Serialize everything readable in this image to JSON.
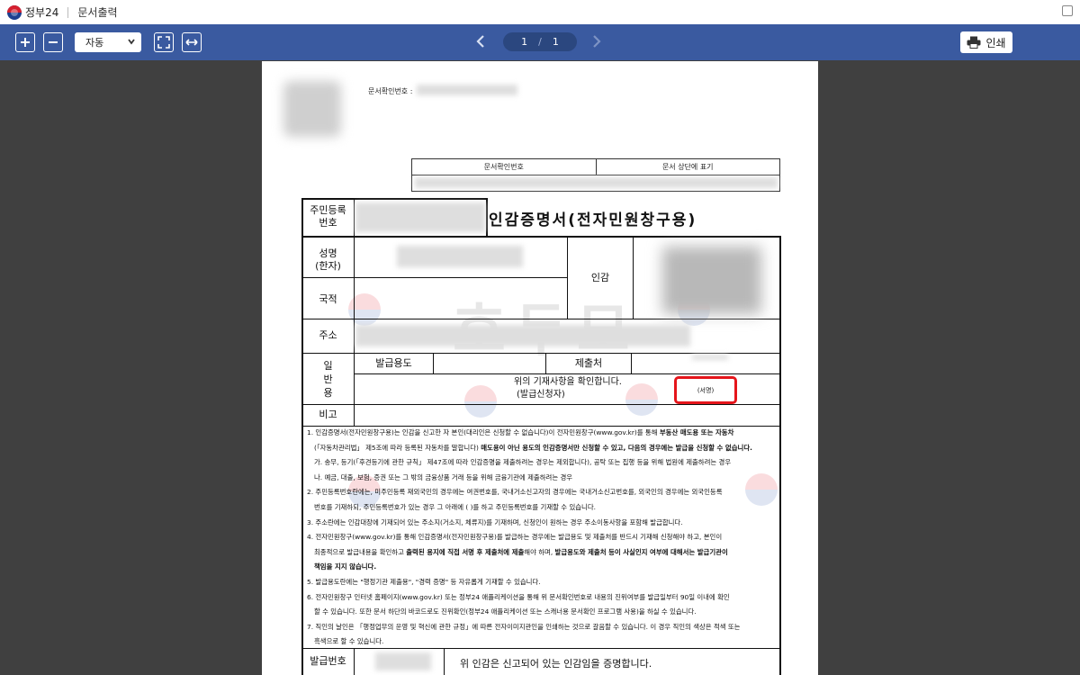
{
  "titlebar": {
    "brand": "정부24",
    "title": "문서출력"
  },
  "toolbar": {
    "zoom_in_icon": "plus-icon",
    "zoom_out_icon": "minus-icon",
    "zoom_select": "자동",
    "fit_page_icon": "expand-icon",
    "fit_width_icon": "arrows-horizontal-icon",
    "current_page": "1",
    "page_separator": "/",
    "total_pages": "1",
    "print_label": "인쇄",
    "accent": "#3a5aa0"
  },
  "document": {
    "confirm_number_label": "문서확인번호 :",
    "confirm_table": {
      "header_left": "문서확인번호",
      "header_right": "문서 상단에 표기"
    },
    "resident_label_1": "주민등록",
    "resident_label_2": "번호",
    "title": "인감증명서(전자민원창구용)",
    "name_label_1": "성명",
    "name_label_2": "(한자)",
    "seal_label": "인감",
    "nationality_label": "국적",
    "address_label": "주소",
    "general_label_1": "일",
    "general_label_2": "반",
    "general_label_3": "용",
    "purpose_label": "발급용도",
    "submit_to_label": "제출처",
    "confirm_statement": "위의 기재사항을 확인합니다.",
    "applicant_label": "(발급신청자)",
    "signature_label": "(서명)",
    "remarks_label": "비고",
    "watermark": "호두모",
    "notes": [
      "1. 인감증명서(전자민원창구용)는 인감을 신고한 자 본인(대리인은 신청할 수 없습니다)이 전자민원창구(www.gov.kr)를 통해 부동산 매도용 또는 자동차",
      "(「자동차관리법」 제5조에 따라 등록된 자동차를 말합니다) 매도용이 아닌 용도의 인감증명서만 신청할 수 있고, 다음의 경우에는 발급을 신청할 수 없습니다.",
      "가. 송무, 등기(「후견등기에 관한 규칙」 제47조에 따라 인감증명을 제출하려는 경우는 제외합니다), 공탁 또는 집행 등을 위해 법원에 제출하려는 경우",
      "나. 예금, 대출, 보험, 증권 또는 그 밖의 금융상품 거래 등을 위해 금융기관에 제출하려는 경우",
      "2. 주민등록번호란에는, 미주민등록 재외국민의 경우에는 여권번호를, 국내거소신고자의 경우에는 국내거소신고번호를, 외국인의 경우에는 외국인등록",
      "번호를 기재하되, 주민등록번호가 있는 경우 그 아래에 ( )를 하고 주민등록번호를 기재할 수 있습니다.",
      "3. 주소란에는 인감대장에 기재되어 있는 주소지(거소지, 체류지)를 기재하며, 신청인이 원하는 경우 주소이동사항을 포함해 발급합니다.",
      "4. 전자민원창구(www.gov.kr)를 통해 인감증명서(전자민원창구용)를 발급하는 경우에는 발급용도 및 제출처를 반드시 기재해 신청해야 하고, 본인이",
      "최종적으로 발급내용을 확인하고 출력된 용지에 직접 서명 후 제출처에 제출해야 하며, 발급용도와 제출처 등이 사실인지 여부에 대해서는 발급기관이",
      "책임을 지지 않습니다.",
      "5. 발급용도란에는 \"행정기관 제출용\", \"경력 증명\" 등 자유롭게 기재할 수 있습니다.",
      "6. 전자민원창구 인터넷 홈페이지(www.gov.kr) 또는 정부24 애플리케이션을 통해 위 문서확인번호로 내용의 진위여부를 발급일부터 90일 이내에 확인",
      "할 수 있습니다. 또한 문서 하단의 바코드로도 진위확인(정부24 애플리케이션 또는 스캐너용 문서확인 프로그램 사용)을 하실 수 있습니다.",
      "7. 직인의 날인은 「행정업무의 운영 및 혁신에 관한 규정」에 따른 전자이미지관인을 인쇄하는 것으로 갈음할 수 있습니다. 이 경우 직인의 색상은 적색 또는",
      "흑색으로 할 수 있습니다."
    ],
    "issue_number_label": "발급번호",
    "certify_statement": "위 인감은 신고되어 있는 인감임을 증명합니다.",
    "signature_box_color": "#e5151b"
  }
}
